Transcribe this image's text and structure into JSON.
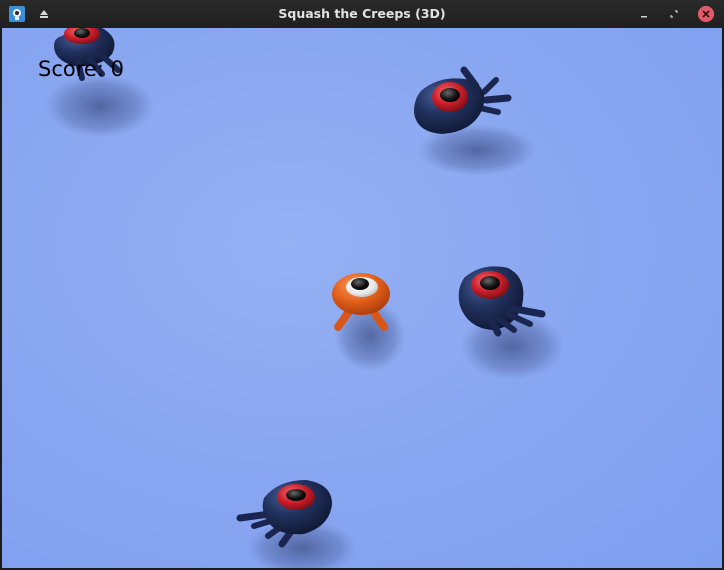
{
  "window": {
    "title": "Squash the Creeps (3D)",
    "app_icon": "godot-engine-icon",
    "menu_icon": "eject-icon",
    "minimize_icon": "minimize-icon",
    "maximize_icon": "restore-icon",
    "close_icon": "close-icon"
  },
  "hud": {
    "score_text": "Score: 0"
  },
  "colors": {
    "ground": "#8aa7f1",
    "player": "#e0601c",
    "mob_body": "#1e2d5c",
    "mob_eye": "#c0202a",
    "close_button": "#e05a6a"
  }
}
